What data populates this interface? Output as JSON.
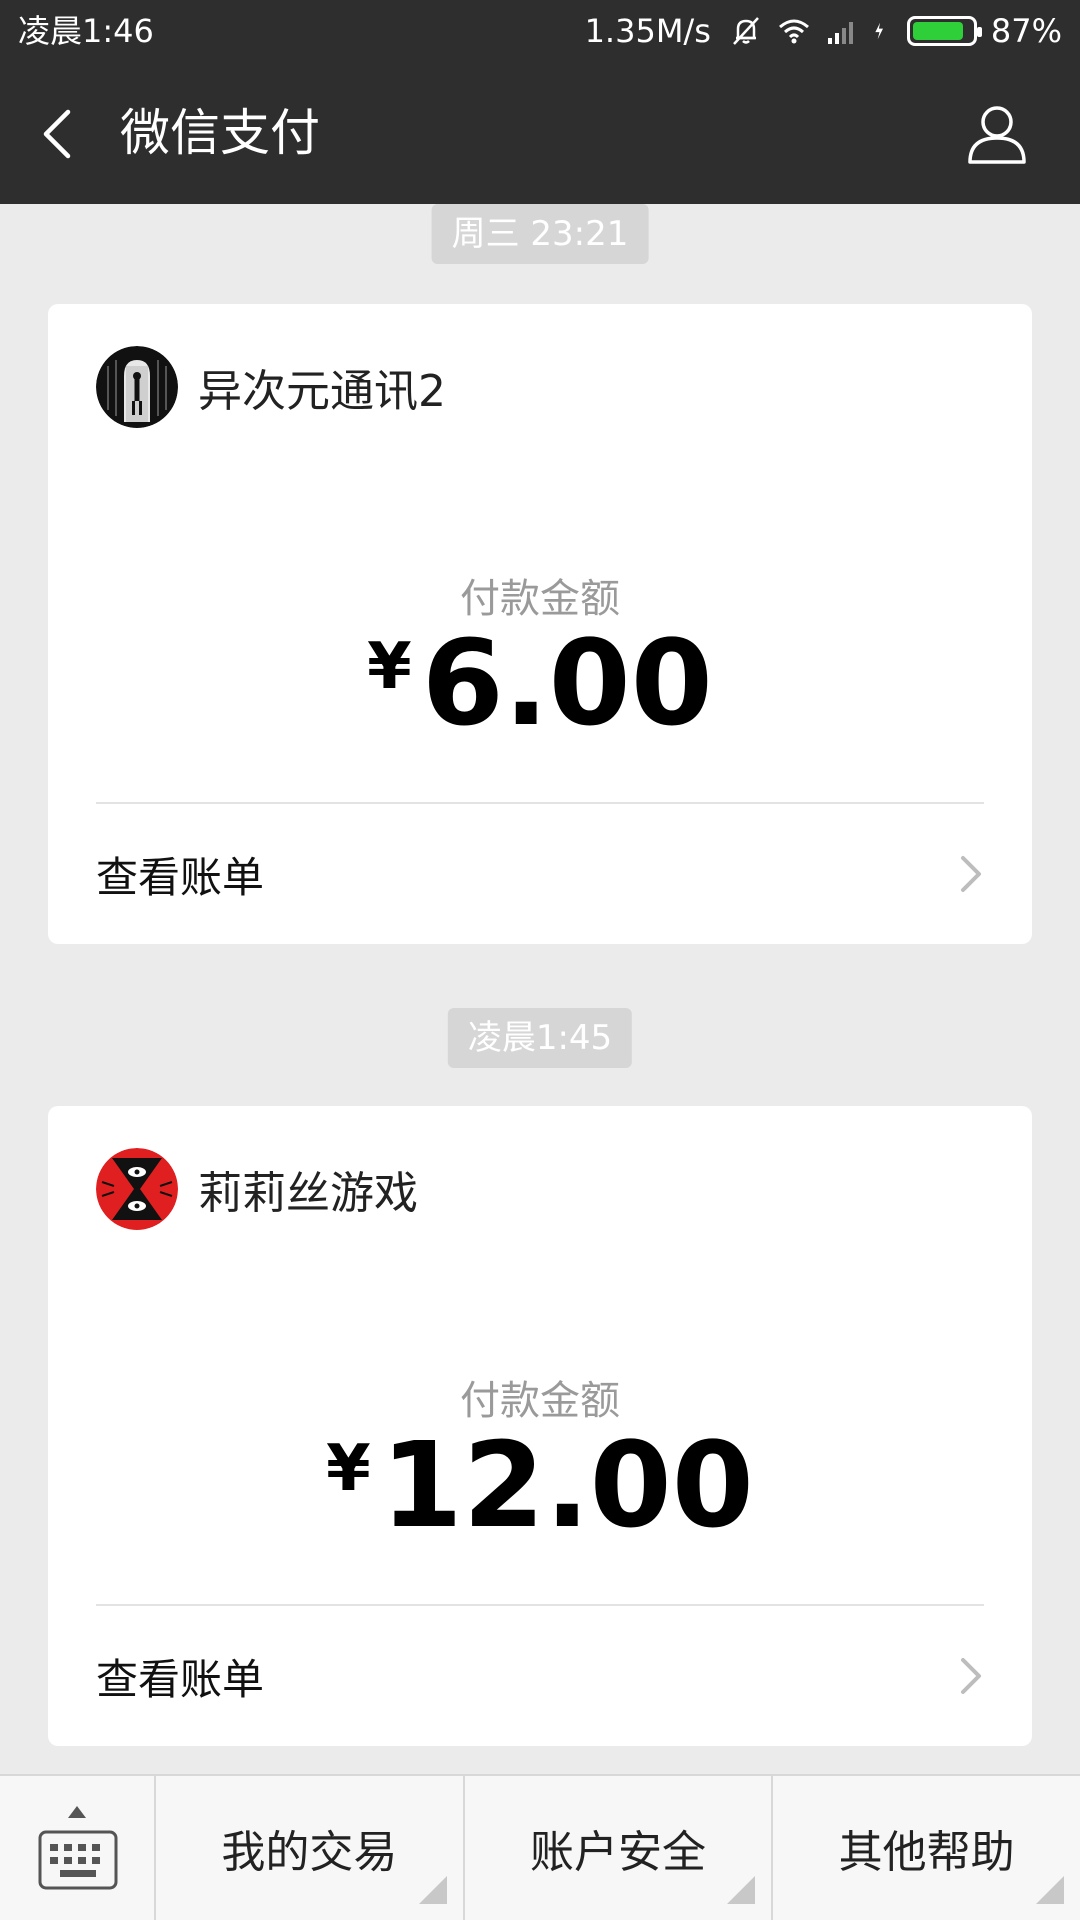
{
  "status_bar": {
    "time": "凌晨1:46",
    "network_speed": "1.35M/s",
    "battery_percent": "87%",
    "battery_level": 0.87
  },
  "header": {
    "title": "微信支付"
  },
  "messages": [
    {
      "timestamp": "周三 23:21",
      "merchant_name": "异次元通讯2",
      "amount_label": "付款金额",
      "currency_symbol": "¥",
      "amount": "6.00",
      "link_label": "查看账单"
    },
    {
      "timestamp": "凌晨1:45",
      "merchant_name": "莉莉丝游戏",
      "amount_label": "付款金额",
      "currency_symbol": "¥",
      "amount": "12.00",
      "link_label": "查看账单"
    }
  ],
  "bottom_menu": {
    "items": [
      {
        "label": "我的交易"
      },
      {
        "label": "账户安全"
      },
      {
        "label": "其他帮助"
      }
    ]
  },
  "colors": {
    "header_bg": "#2e2e2e",
    "page_bg": "#ebebeb",
    "battery_fill": "#2ecf39",
    "lilith_red": "#e02020"
  },
  "icons": [
    "back-icon",
    "profile-icon",
    "mute-icon",
    "wifi-icon",
    "signal-icon",
    "charging-icon",
    "chevron-right-icon",
    "keyboard-icon"
  ]
}
